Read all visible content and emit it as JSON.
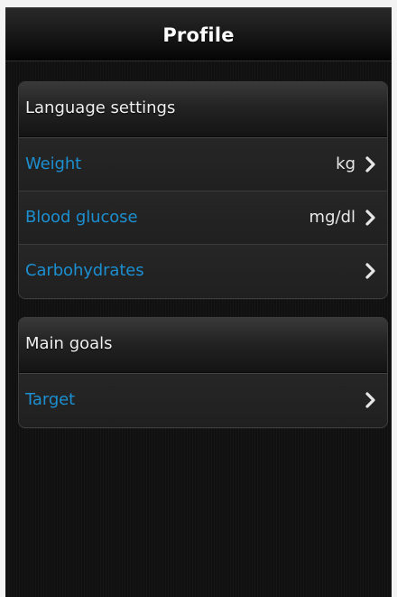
{
  "header": {
    "title": "Profile"
  },
  "sections": [
    {
      "title": "Language settings",
      "items": [
        {
          "label": "Weight",
          "value": "kg",
          "icon": "chevron-right-icon"
        },
        {
          "label": "Blood glucose",
          "value": "mg/dl",
          "icon": "chevron-right-icon"
        },
        {
          "label": "Carbohydrates",
          "value": "",
          "icon": "chevron-right-icon"
        }
      ]
    },
    {
      "title": "Main goals",
      "items": [
        {
          "label": "Target",
          "value": "",
          "icon": "chevron-right-icon"
        }
      ]
    }
  ],
  "colors": {
    "background": "#101010",
    "header": "#1a1a1a",
    "link": "#1c8fd0",
    "text": "#f1f1f1"
  }
}
